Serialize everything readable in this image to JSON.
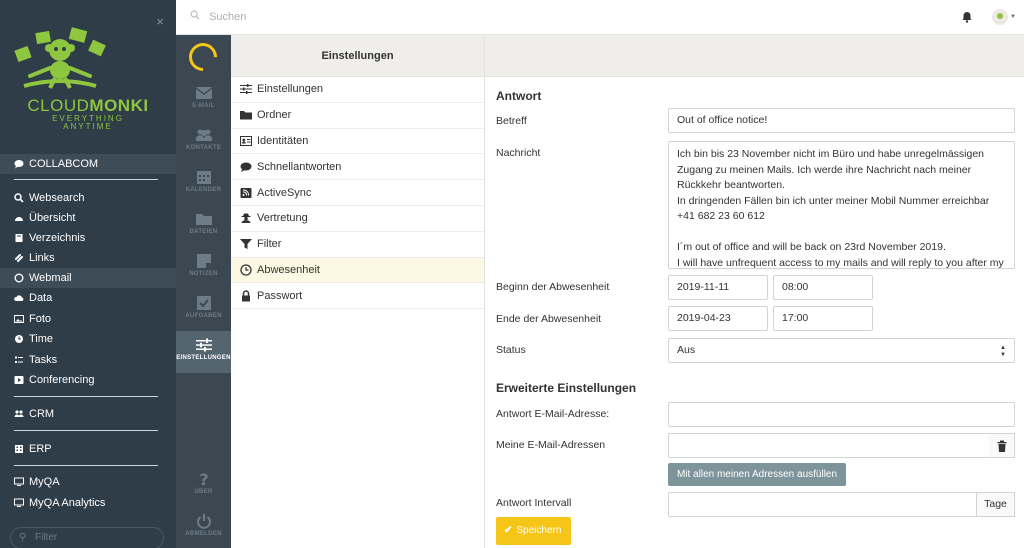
{
  "sidebar": {
    "close": "×",
    "logo": {
      "brand_part1": "CLOUD",
      "brand_part2": "MONKI",
      "tagline_1": "EVERYTHING",
      "tagline_2": "ANYTIME"
    },
    "items": [
      {
        "label": "COLLABCOM",
        "icon": "chat-icon"
      },
      {
        "label": "Websearch",
        "icon": "search-icon"
      },
      {
        "label": "Übersicht",
        "icon": "dashboard-icon"
      },
      {
        "label": "Verzeichnis",
        "icon": "book-icon"
      },
      {
        "label": "Links",
        "icon": "link-icon"
      },
      {
        "label": "Webmail",
        "icon": "circle-icon"
      },
      {
        "label": "Data",
        "icon": "cloud-icon"
      },
      {
        "label": "Foto",
        "icon": "image-icon"
      },
      {
        "label": "Time",
        "icon": "clock-icon"
      },
      {
        "label": "Tasks",
        "icon": "tasks-icon"
      },
      {
        "label": "Conferencing",
        "icon": "video-icon"
      },
      {
        "label": "CRM",
        "icon": "users-icon"
      },
      {
        "label": "ERP",
        "icon": "building-icon"
      },
      {
        "label": "MyQA",
        "icon": "monitor-icon"
      },
      {
        "label": "MyQA Analytics",
        "icon": "monitor-icon"
      }
    ],
    "filter_placeholder": "Filter"
  },
  "topbar": {
    "search_placeholder": "Suchen"
  },
  "rail": {
    "items": [
      {
        "label": "E-MAIL",
        "icon": "envelope-icon"
      },
      {
        "label": "KONTAKTE",
        "icon": "users-icon"
      },
      {
        "label": "KALENDER",
        "icon": "calendar-icon"
      },
      {
        "label": "DATEIEN",
        "icon": "folder-icon"
      },
      {
        "label": "NOTIZEN",
        "icon": "note-icon"
      },
      {
        "label": "AUFGABEN",
        "icon": "checkbox-icon"
      },
      {
        "label": "EINSTELLUNGEN",
        "icon": "sliders-icon"
      },
      {
        "label": "ÜBER",
        "icon": "question-icon"
      },
      {
        "label": "ABMELDEN",
        "icon": "power-icon"
      }
    ]
  },
  "settings": {
    "header": "Einstellungen",
    "items": [
      {
        "label": "Einstellungen",
        "icon": "sliders-icon"
      },
      {
        "label": "Ordner",
        "icon": "folder-icon"
      },
      {
        "label": "Identitäten",
        "icon": "id-card-icon"
      },
      {
        "label": "Schnellantworten",
        "icon": "comment-icon"
      },
      {
        "label": "ActiveSync",
        "icon": "rss-icon"
      },
      {
        "label": "Vertretung",
        "icon": "user-secret-icon"
      },
      {
        "label": "Filter",
        "icon": "filter-icon"
      },
      {
        "label": "Abwesenheit",
        "icon": "clock-icon"
      },
      {
        "label": "Passwort",
        "icon": "lock-icon"
      }
    ]
  },
  "form": {
    "section_title": "Antwort",
    "subject_label": "Betreff",
    "subject_value": "Out of office notice!",
    "message_label": "Nachricht",
    "message_value": "Ich bin bis 23 November nicht im Büro und habe unregelmässigen Zugang zu meinen Mails. Ich werde ihre Nachricht nach meiner Rückkehr beantworten.\nIn dringenden Fällen bin ich unter meiner Mobil Nummer erreichbar +41 682 23 60 612\n\nI´m out of office and will be back on 23rd November 2019.\nI will have unfrequent access to my mails and will reply to you after my",
    "start_label": "Beginn der Abwesenheit",
    "start_date": "2019-11-11",
    "start_time": "08:00",
    "end_label": "Ende der Abwesenheit",
    "end_date": "2019-04-23",
    "end_time": "17:00",
    "status_label": "Status",
    "status_value": "Aus",
    "advanced_title": "Erweiterte Einstellungen",
    "reply_email_label": "Antwort E-Mail-Adresse:",
    "my_emails_label": "Meine E-Mail-Adressen",
    "fill_button": "Mit allen meinen Adressen ausfüllen",
    "interval_label": "Antwort Intervall",
    "interval_suffix": "Tage",
    "save_button": "Speichern"
  },
  "colors": {
    "accent": "#f5c518",
    "sidebar_bg": "#2f3d48",
    "rail_bg": "#3b4852",
    "brand_green": "#8ec63f"
  }
}
